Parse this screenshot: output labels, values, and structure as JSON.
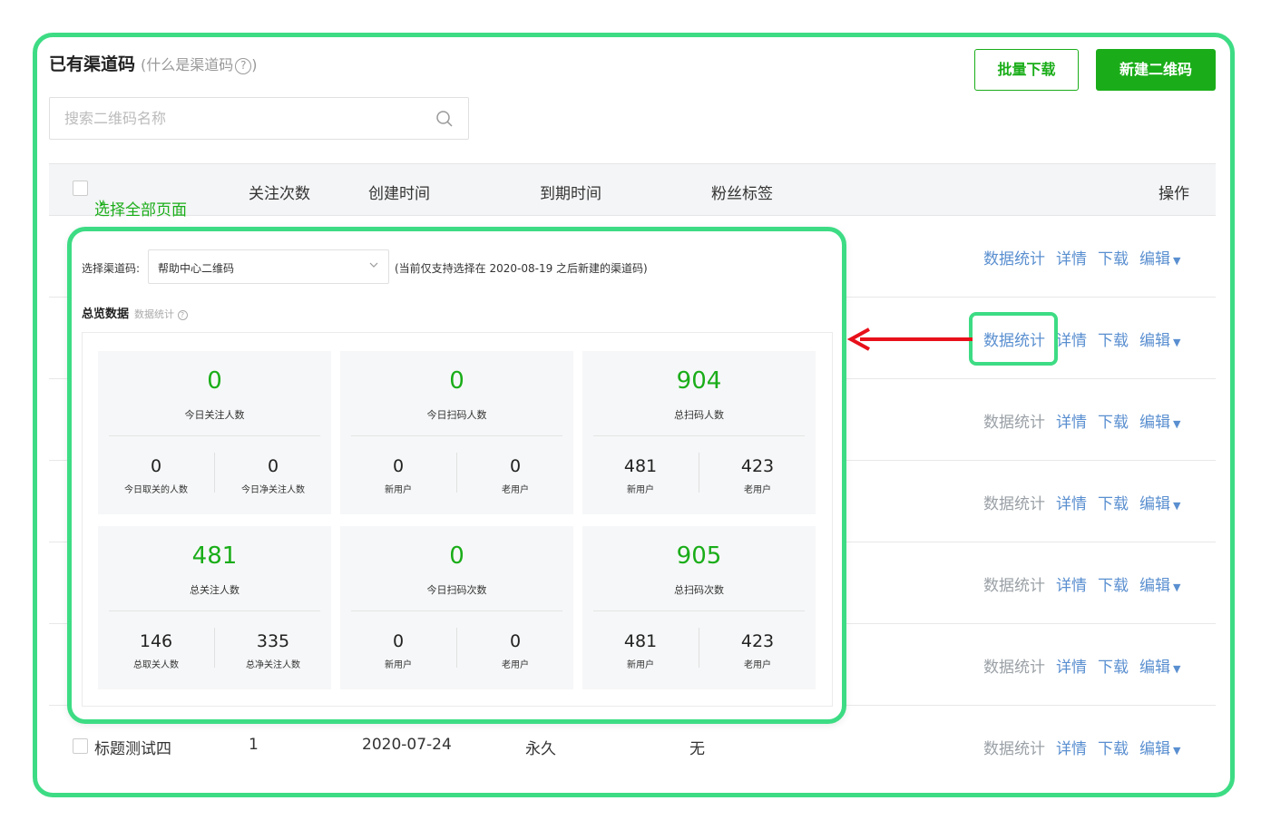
{
  "header": {
    "title": "已有渠道码",
    "subtitle": "(什么是渠道码",
    "subtitle_end": ")",
    "help_glyph": "?",
    "bulk_download": "批量下载",
    "new_qr": "新建二维码"
  },
  "search": {
    "placeholder": "搜索二维码名称"
  },
  "table": {
    "columns": {
      "select_all": "选择全部页面",
      "follow_count": "关注次数",
      "created": "创建时间",
      "expires": "到期时间",
      "fan_tag": "粉丝标签",
      "actions": "操作"
    },
    "actions": {
      "stats": "数据统计",
      "detail": "详情",
      "download": "下载",
      "edit": "编辑"
    },
    "last_row": {
      "name": "标题测试四",
      "follow_count": "1",
      "created": "2020-07-24",
      "expires": "永久",
      "fan_tag": "无"
    }
  },
  "popup": {
    "select_label": "选择渠道码:",
    "select_value": "帮助中心二维码",
    "note": "(当前仅支持选择在 2020-08-19 之后新建的渠道码)",
    "overview_title": "总览数据",
    "overview_sub": "数据统计",
    "cards": [
      {
        "value": "0",
        "label": "今日关注人数",
        "left_value": "0",
        "left_label": "今日取关的人数",
        "right_value": "0",
        "right_label": "今日净关注人数"
      },
      {
        "value": "0",
        "label": "今日扫码人数",
        "left_value": "0",
        "left_label": "新用户",
        "right_value": "0",
        "right_label": "老用户"
      },
      {
        "value": "904",
        "label": "总扫码人数",
        "left_value": "481",
        "left_label": "新用户",
        "right_value": "423",
        "right_label": "老用户"
      },
      {
        "value": "481",
        "label": "总关注人数",
        "left_value": "146",
        "left_label": "总取关人数",
        "right_value": "335",
        "right_label": "总净关注人数"
      },
      {
        "value": "0",
        "label": "今日扫码次数",
        "left_value": "0",
        "left_label": "新用户",
        "right_value": "0",
        "right_label": "老用户"
      },
      {
        "value": "905",
        "label": "总扫码次数",
        "left_value": "481",
        "left_label": "新用户",
        "right_value": "423",
        "right_label": "老用户"
      }
    ]
  },
  "colors": {
    "accent_green": "#1aad19",
    "highlight_green": "#3ddc84",
    "link_blue": "#5a8fd0",
    "arrow_red": "#e8101a"
  }
}
